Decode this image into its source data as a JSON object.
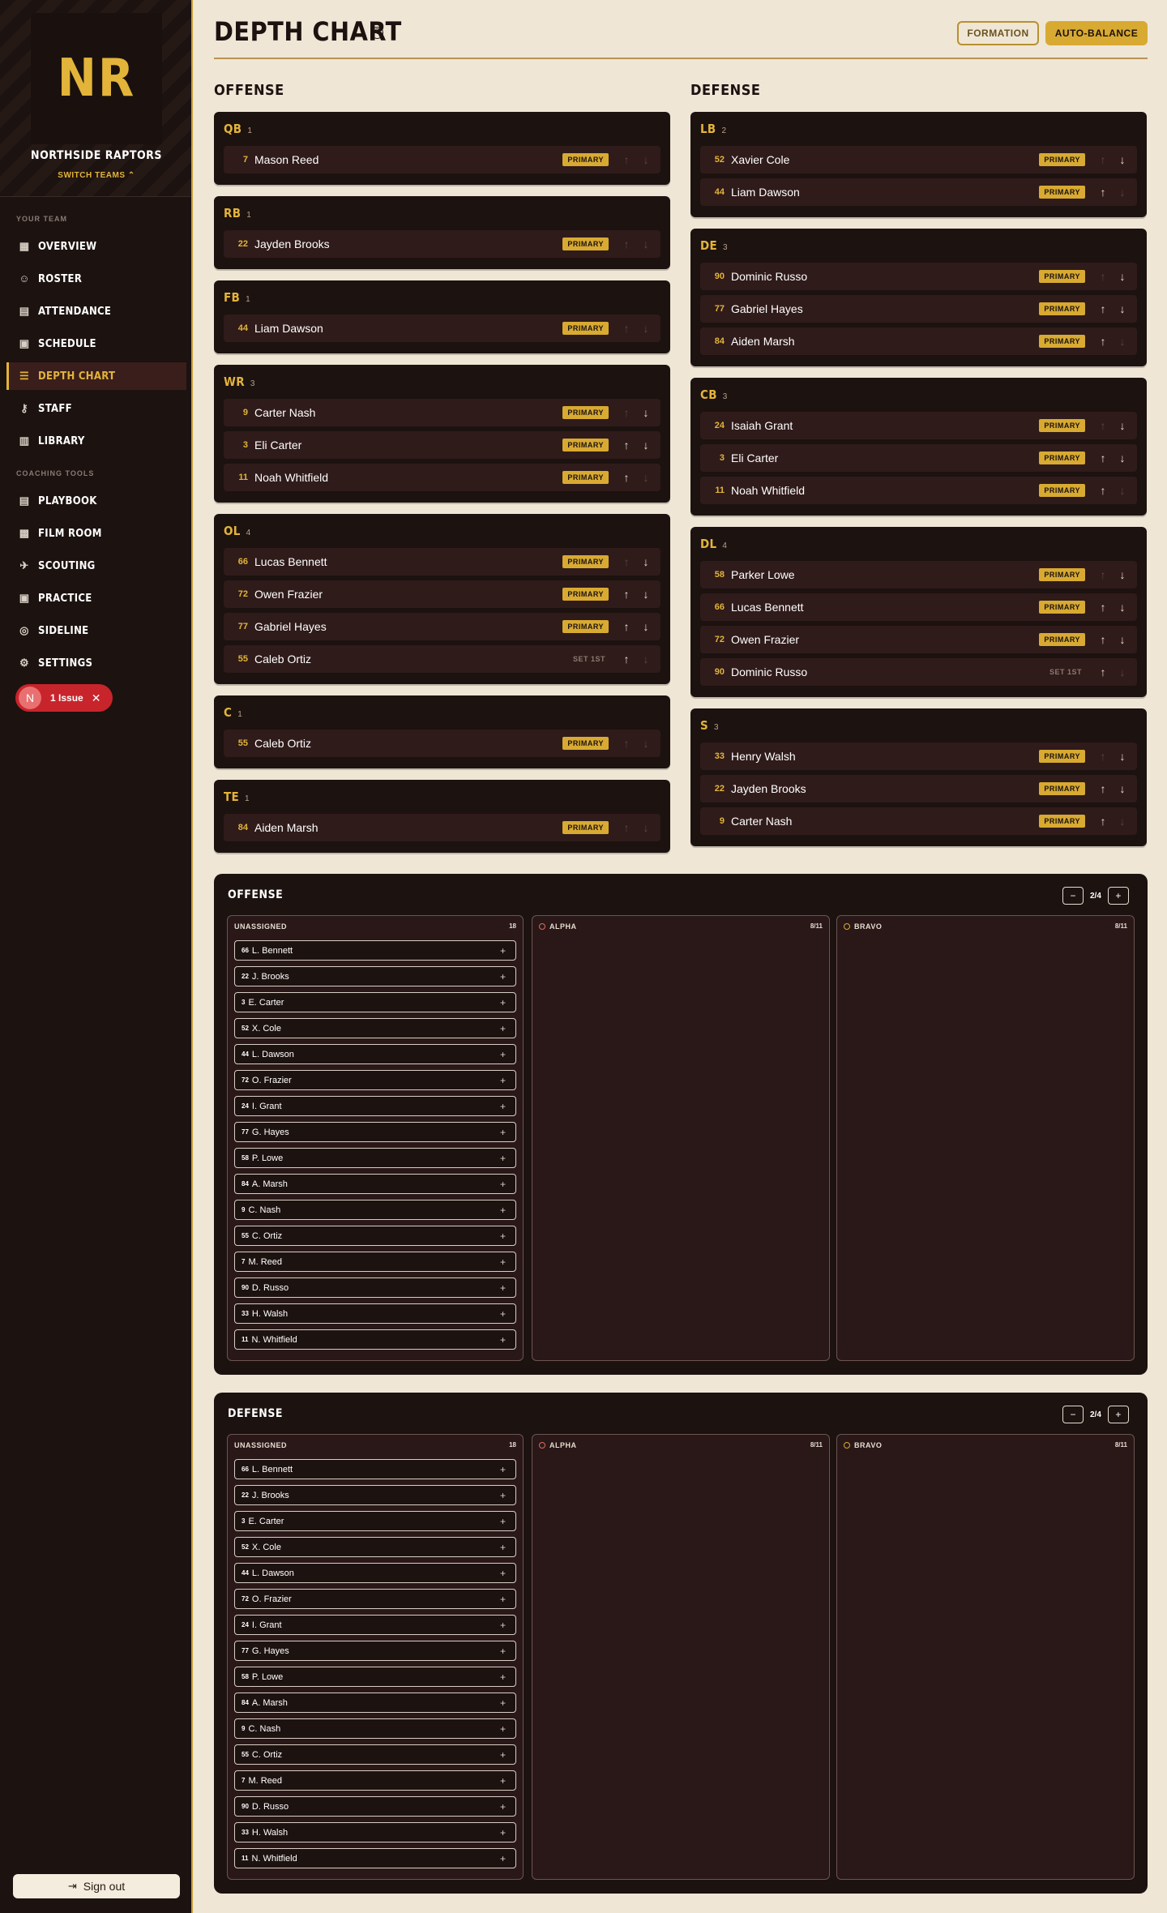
{
  "team": {
    "initials": "NR",
    "name": "NORTHSIDE RAPTORS",
    "switch_label": "SWITCH TEAMS"
  },
  "sidebar": {
    "your_team_label": "YOUR TEAM",
    "your_team": [
      {
        "label": "OVERVIEW",
        "icon": "grid-icon"
      },
      {
        "label": "ROSTER",
        "icon": "users-icon"
      },
      {
        "label": "ATTENDANCE",
        "icon": "clipboard-icon"
      },
      {
        "label": "SCHEDULE",
        "icon": "calendar-icon"
      },
      {
        "label": "DEPTH CHART",
        "icon": "list-icon"
      },
      {
        "label": "STAFF",
        "icon": "user-key-icon"
      },
      {
        "label": "LIBRARY",
        "icon": "book-icon"
      }
    ],
    "coaching_label": "COACHING TOOLS",
    "coaching": [
      {
        "label": "PLAYBOOK",
        "icon": "clipboard-icon"
      },
      {
        "label": "FILM ROOM",
        "icon": "film-icon"
      },
      {
        "label": "SCOUTING",
        "icon": "telescope-icon"
      },
      {
        "label": "PRACTICE",
        "icon": "calendar-icon"
      },
      {
        "label": "SIDELINE",
        "icon": "radar-icon"
      },
      {
        "label": "SETTINGS",
        "icon": "gear-icon"
      }
    ],
    "issue": {
      "avatar": "N",
      "label": "1 Issue"
    },
    "signout_label": "Sign out"
  },
  "page": {
    "title": "DEPTH CHART",
    "formation_label": "FORMATION",
    "auto_balance_label": "AUTO-BALANCE"
  },
  "offense_label": "OFFENSE",
  "defense_label": "DEFENSE",
  "offense": [
    {
      "abbr": "QB",
      "count": "1",
      "players": [
        {
          "num": "7",
          "name": "Mason Reed",
          "tag": "PRIMARY",
          "up": false,
          "down": false
        }
      ]
    },
    {
      "abbr": "RB",
      "count": "1",
      "players": [
        {
          "num": "22",
          "name": "Jayden Brooks",
          "tag": "PRIMARY",
          "up": false,
          "down": false
        }
      ]
    },
    {
      "abbr": "FB",
      "count": "1",
      "players": [
        {
          "num": "44",
          "name": "Liam Dawson",
          "tag": "PRIMARY",
          "up": false,
          "down": false
        }
      ]
    },
    {
      "abbr": "WR",
      "count": "3",
      "players": [
        {
          "num": "9",
          "name": "Carter Nash",
          "tag": "PRIMARY",
          "up": false,
          "down": true
        },
        {
          "num": "3",
          "name": "Eli Carter",
          "tag": "PRIMARY",
          "up": true,
          "down": true
        },
        {
          "num": "11",
          "name": "Noah Whitfield",
          "tag": "PRIMARY",
          "up": true,
          "down": false
        }
      ]
    },
    {
      "abbr": "OL",
      "count": "4",
      "players": [
        {
          "num": "66",
          "name": "Lucas Bennett",
          "tag": "PRIMARY",
          "up": false,
          "down": true
        },
        {
          "num": "72",
          "name": "Owen Frazier",
          "tag": "PRIMARY",
          "up": true,
          "down": true
        },
        {
          "num": "77",
          "name": "Gabriel Hayes",
          "tag": "PRIMARY",
          "up": true,
          "down": true
        },
        {
          "num": "55",
          "name": "Caleb Ortiz",
          "tag": "SET 1ST",
          "up": true,
          "down": false
        }
      ]
    },
    {
      "abbr": "C",
      "count": "1",
      "players": [
        {
          "num": "55",
          "name": "Caleb Ortiz",
          "tag": "PRIMARY",
          "up": false,
          "down": false
        }
      ]
    },
    {
      "abbr": "TE",
      "count": "1",
      "players": [
        {
          "num": "84",
          "name": "Aiden Marsh",
          "tag": "PRIMARY",
          "up": false,
          "down": false
        }
      ]
    }
  ],
  "defense": [
    {
      "abbr": "LB",
      "count": "2",
      "players": [
        {
          "num": "52",
          "name": "Xavier Cole",
          "tag": "PRIMARY",
          "up": false,
          "down": true
        },
        {
          "num": "44",
          "name": "Liam Dawson",
          "tag": "PRIMARY",
          "up": true,
          "down": false
        }
      ]
    },
    {
      "abbr": "DE",
      "count": "3",
      "players": [
        {
          "num": "90",
          "name": "Dominic Russo",
          "tag": "PRIMARY",
          "up": false,
          "down": true
        },
        {
          "num": "77",
          "name": "Gabriel Hayes",
          "tag": "PRIMARY",
          "up": true,
          "down": true
        },
        {
          "num": "84",
          "name": "Aiden Marsh",
          "tag": "PRIMARY",
          "up": true,
          "down": false
        }
      ]
    },
    {
      "abbr": "CB",
      "count": "3",
      "players": [
        {
          "num": "24",
          "name": "Isaiah Grant",
          "tag": "PRIMARY",
          "up": false,
          "down": true
        },
        {
          "num": "3",
          "name": "Eli Carter",
          "tag": "PRIMARY",
          "up": true,
          "down": true
        },
        {
          "num": "11",
          "name": "Noah Whitfield",
          "tag": "PRIMARY",
          "up": true,
          "down": false
        }
      ]
    },
    {
      "abbr": "DL",
      "count": "4",
      "players": [
        {
          "num": "58",
          "name": "Parker Lowe",
          "tag": "PRIMARY",
          "up": false,
          "down": true
        },
        {
          "num": "66",
          "name": "Lucas Bennett",
          "tag": "PRIMARY",
          "up": true,
          "down": true
        },
        {
          "num": "72",
          "name": "Owen Frazier",
          "tag": "PRIMARY",
          "up": true,
          "down": true
        },
        {
          "num": "90",
          "name": "Dominic Russo",
          "tag": "SET 1ST",
          "up": true,
          "down": false
        }
      ]
    },
    {
      "abbr": "S",
      "count": "3",
      "players": [
        {
          "num": "33",
          "name": "Henry Walsh",
          "tag": "PRIMARY",
          "up": false,
          "down": true
        },
        {
          "num": "22",
          "name": "Jayden Brooks",
          "tag": "PRIMARY",
          "up": true,
          "down": true
        },
        {
          "num": "9",
          "name": "Carter Nash",
          "tag": "PRIMARY",
          "up": true,
          "down": false
        }
      ]
    }
  ],
  "assign_panels": [
    {
      "title": "OFFENSE",
      "minus": "−",
      "value": "2/4",
      "plus": "+"
    },
    {
      "title": "DEFENSE",
      "minus": "−",
      "value": "2/4",
      "plus": "+"
    }
  ],
  "unassigned": {
    "label": "UNASSIGNED",
    "count": "18",
    "add_symbol": "+",
    "players": [
      {
        "num": "66",
        "name": "L. Bennett"
      },
      {
        "num": "22",
        "name": "J. Brooks"
      },
      {
        "num": "3",
        "name": "E. Carter"
      },
      {
        "num": "52",
        "name": "X. Cole"
      },
      {
        "num": "44",
        "name": "L. Dawson"
      },
      {
        "num": "72",
        "name": "O. Frazier"
      },
      {
        "num": "24",
        "name": "I. Grant"
      },
      {
        "num": "77",
        "name": "G. Hayes"
      },
      {
        "num": "58",
        "name": "P. Lowe"
      },
      {
        "num": "84",
        "name": "A. Marsh"
      },
      {
        "num": "9",
        "name": "C. Nash"
      },
      {
        "num": "55",
        "name": "C. Ortiz"
      },
      {
        "num": "7",
        "name": "M. Reed"
      },
      {
        "num": "90",
        "name": "D. Russo"
      },
      {
        "num": "33",
        "name": "H. Walsh"
      },
      {
        "num": "11",
        "name": "N. Whitfield"
      }
    ]
  },
  "groups": [
    {
      "name": "ALPHA",
      "count": "8/11",
      "color": "#e06a5a"
    },
    {
      "name": "BRAVO",
      "count": "8/11",
      "color": "#d8aa32"
    }
  ],
  "colors": {
    "accent": "#e3b43a",
    "sidebar_bg": "#1c1210",
    "page_bg": "#efe6d5",
    "danger": "#c8242b"
  }
}
